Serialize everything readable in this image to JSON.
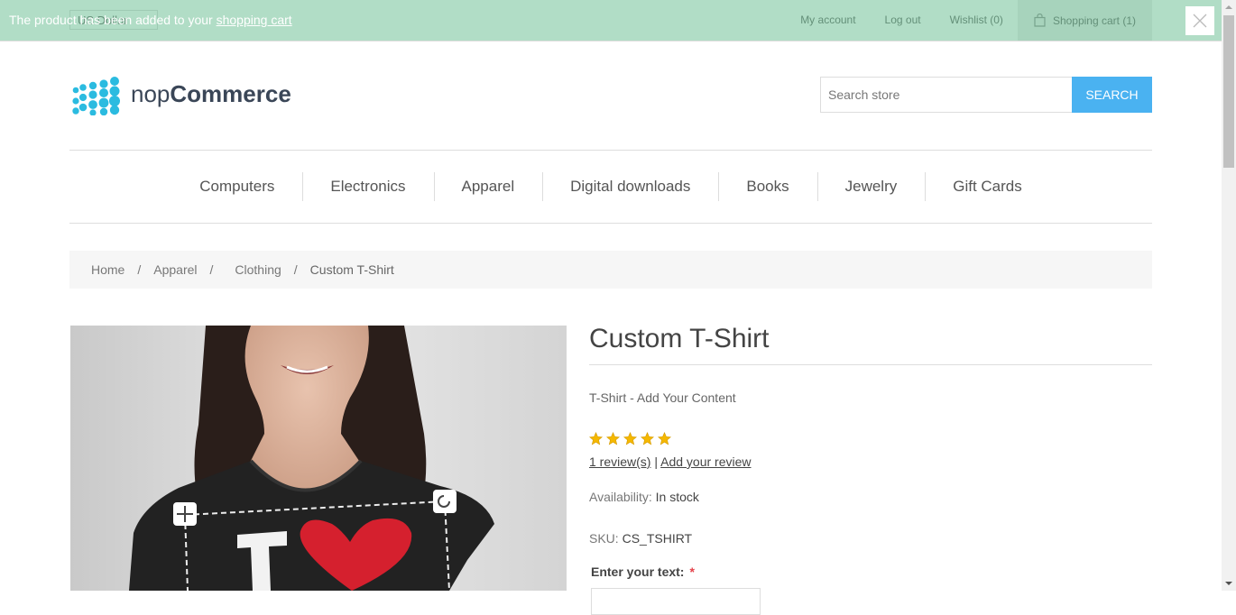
{
  "header": {
    "currency": "US Dollar",
    "links": {
      "my_account": "My account",
      "log_out": "Log out",
      "wishlist": "Wishlist (0)",
      "shopping_cart": "Shopping cart (1)"
    }
  },
  "notification": {
    "text_before": "The product has been added to your",
    "link_text": "shopping cart"
  },
  "logo": {
    "prefix": "nop",
    "brand": "Commerce"
  },
  "search": {
    "placeholder": "Search store",
    "button_label": "Search"
  },
  "menu": {
    "items": [
      "Computers",
      "Electronics",
      "Apparel",
      "Digital downloads",
      "Books",
      "Jewelry",
      "Gift Cards"
    ]
  },
  "breadcrumb": {
    "items": [
      "Home",
      "Apparel",
      "Clothing"
    ],
    "current": "Custom T-Shirt",
    "delimiter": "/"
  },
  "product": {
    "name": "Custom T-Shirt",
    "short_description": "T-Shirt - Add Your Content",
    "rating_stars": 5,
    "review_link": "1 review(s)",
    "separator": "|",
    "add_review_link": "Add your review",
    "availability_label": "Availability:",
    "availability_value": "In stock",
    "sku_label": "SKU:",
    "sku_value": "CS_TSHIRT",
    "attribute_label": "Enter your text:",
    "required_mark": "*"
  },
  "colors": {
    "notification_bg": "#4bb07a",
    "search_button": "#4ab2f1",
    "logo_dots": "#2bbbe0",
    "star": "#f5b800"
  }
}
